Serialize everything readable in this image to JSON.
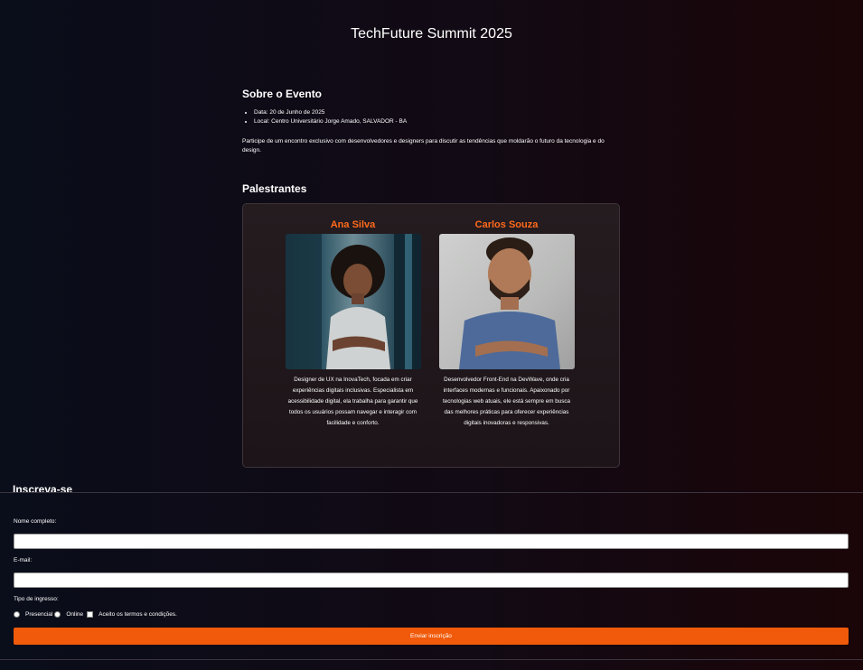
{
  "header": {
    "title": "TechFuture Summit 2025"
  },
  "about": {
    "heading": "Sobre o Evento",
    "details": [
      "Data: 20 de Junho de 2025",
      "Local: Centro Universitário Jorge Amado, SALVADOR - BA"
    ],
    "description": "Participe de um encontro exclusivo com desenvolvedores e designers para discutir as tendências que moldarão o futuro da tecnologia e do design."
  },
  "speakers": {
    "heading": "Palestrantes",
    "items": [
      {
        "name": "Ana Silva",
        "bio": "Designer de UX na InovaTech, focada em criar experiências digitais inclusivas. Especialista em acessibilidade digital, ela trabalha para garantir que todos os usuários possam navegar e interagir com facilidade e conforto."
      },
      {
        "name": "Carlos Souza",
        "bio": "Desenvolvedor Front-End na DevWave, onde cria interfaces modernas e funcionais. Apaixonado por tecnologias web atuais, ele está sempre em busca das melhores práticas para oferecer experiências digitais inovadoras e responsivas."
      }
    ]
  },
  "signup": {
    "heading": "Inscreva-se",
    "name_label": "Nome completo:",
    "name_value": "",
    "email_label": "E-mail:",
    "email_value": "",
    "ticket_label": "Tipo de ingresso:",
    "option_presencial": "Presencial",
    "option_online": "Online",
    "terms_label": "Aceito os termos e condições.",
    "submit_label": "Enviar inscrição"
  },
  "colors": {
    "accent": "#f05a0a",
    "speaker_name": "#ff6a1a"
  }
}
